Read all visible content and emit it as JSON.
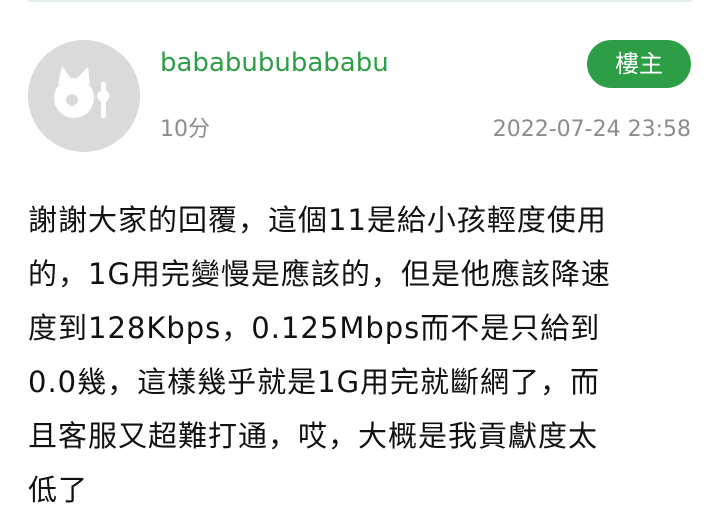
{
  "post": {
    "username": "bababububababu",
    "badge": "樓主",
    "score": "10分",
    "timestamp": "2022-07-24 23:58",
    "body_lines": [
      "謝謝大家的回覆，這個11是給小孩輕度使用",
      "的，1G用完變慢是應該的，但是他應該降速",
      "度到128Kbps，0.125Mbps而不是只給到",
      "0.0幾，這樣幾乎就是1G用完就斷網了，而",
      "且客服又超難打通，哎，大概是我貢獻度太",
      "低了"
    ]
  },
  "colors": {
    "accent": "#2e9e46",
    "meta_text": "#8c8c8c",
    "avatar_bg": "#dadada"
  },
  "icons": {
    "avatar": "default-avatar-icon"
  }
}
